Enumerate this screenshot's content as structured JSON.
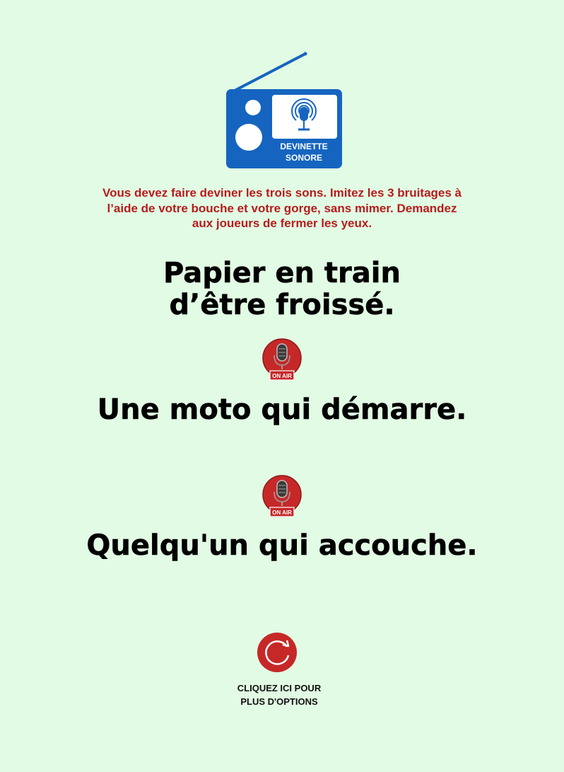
{
  "logo": {
    "line1": "DEVINETTE",
    "line2": "SONORE",
    "color": "#1565c0"
  },
  "instructions": "Vous devez faire deviner les trois sons. Imitez les 3 bruitages à l’aide de votre bouche et votre gorge, sans mimer. Demandez aux joueurs de fermer les yeux.",
  "sounds": {
    "first": {
      "line1": "Papier en train",
      "line2": "d’être froissé."
    },
    "second": "Une moto qui démarre.",
    "third": "Quelqu'un qui accouche."
  },
  "onair_badge": "ON AIR",
  "options": {
    "line1": "CLIQUEZ ICI POUR",
    "line2": "PLUS D'OPTIONS"
  },
  "colors": {
    "background": "#e2fbe4",
    "instructions": "#b71c1c",
    "badge": "#c62828"
  }
}
